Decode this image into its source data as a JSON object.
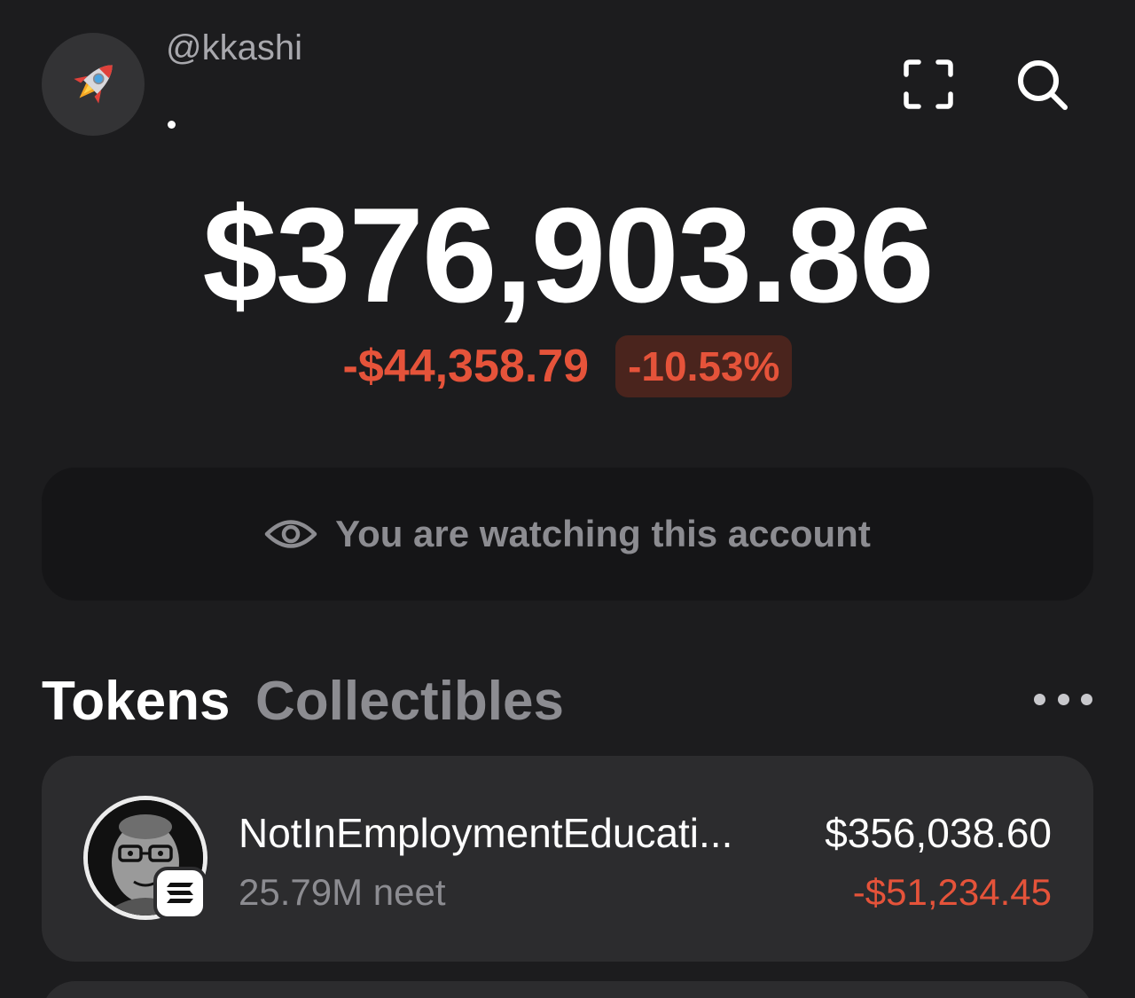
{
  "header": {
    "username": "@kkashi",
    "avatar_icon": "rocket-icon",
    "scan_icon": "scan-icon",
    "search_icon": "search-icon"
  },
  "balance": {
    "total": "$376,903.86",
    "change_value": "-$44,358.79",
    "change_percent": "-10.53%"
  },
  "watch_banner": {
    "icon": "eye-icon",
    "text": "You are watching this account"
  },
  "tabs": [
    {
      "label": "Tokens",
      "active": true
    },
    {
      "label": "Collectibles",
      "active": false
    }
  ],
  "more_icon": "more-dots-icon",
  "tokens": [
    {
      "name": "NotInEmploymentEducati...",
      "amount": "25.79M neet",
      "value": "$356,038.60",
      "change": "-$51,234.45",
      "chain_icon": "solana-icon"
    }
  ],
  "colors": {
    "background": "#1c1c1e",
    "card": "#2c2c2e",
    "negative": "#e5533a",
    "muted": "#8c8c91"
  }
}
